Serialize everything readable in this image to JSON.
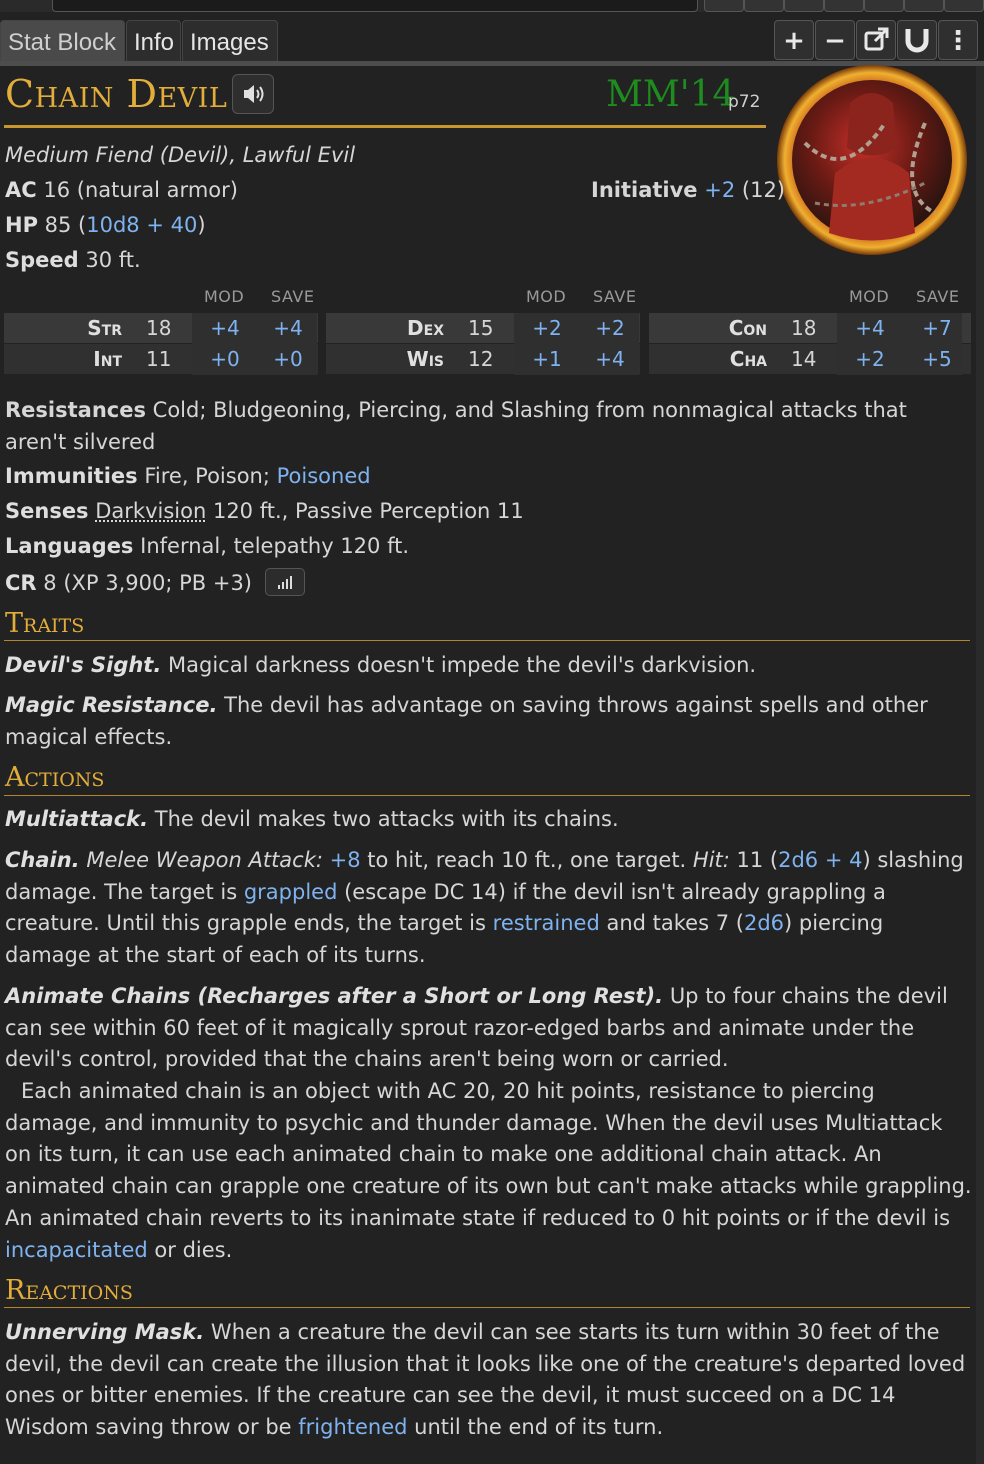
{
  "tabs": [
    {
      "label": "Stat Block",
      "active": true
    },
    {
      "label": "Info",
      "active": false
    },
    {
      "label": "Images",
      "active": false
    }
  ],
  "toolbar": {
    "icons": [
      "plus-icon",
      "minus-icon",
      "popout-icon",
      "magnet-icon",
      "more-vertical-icon"
    ],
    "plus": "+",
    "minus": "−",
    "more": "⋮"
  },
  "monster": {
    "name": "Chain Devil",
    "source": "MM'14",
    "page": "p72",
    "type": "Medium Fiend (Devil), Lawful Evil",
    "ac_label": "AC",
    "ac_value": "16 (natural armor)",
    "initiative_label": "Initiative",
    "initiative_mod": "+2",
    "initiative_score": "(12)",
    "hp_label": "HP",
    "hp_value": "85 (",
    "hp_formula": "10d8 + 40",
    "hp_close": ")",
    "speed_label": "Speed",
    "speed_value": "30 ft."
  },
  "abilities": {
    "mod_header": "MOD",
    "save_header": "SAVE",
    "groups": [
      {
        "rows": [
          {
            "name": "Str",
            "score": "18",
            "mod": "+4",
            "save": "+4"
          },
          {
            "name": "Int",
            "score": "11",
            "mod": "+0",
            "save": "+0"
          }
        ]
      },
      {
        "rows": [
          {
            "name": "Dex",
            "score": "15",
            "mod": "+2",
            "save": "+2"
          },
          {
            "name": "Wis",
            "score": "12",
            "mod": "+1",
            "save": "+4"
          }
        ]
      },
      {
        "rows": [
          {
            "name": "Con",
            "score": "18",
            "mod": "+4",
            "save": "+7"
          },
          {
            "name": "Cha",
            "score": "14",
            "mod": "+2",
            "save": "+5"
          }
        ]
      }
    ]
  },
  "details": {
    "resistances_label": "Resistances",
    "resistances_value": "Cold; Bludgeoning, Piercing, and Slashing from nonmagical attacks that",
    "resistances_value2": "aren't silvered",
    "immunities_label": "Immunities",
    "immunities_value": "Fire, Poison; ",
    "immunities_link": "Poisoned",
    "senses_label": "Senses",
    "senses_link": "Darkvision",
    "senses_value": " 120 ft., Passive Perception 11",
    "languages_label": "Languages",
    "languages_value": "Infernal, telepathy 120 ft.",
    "cr_label": "CR",
    "cr_value": "8 (XP 3,900; PB +3)"
  },
  "sections": {
    "traits": "Traits",
    "actions": "Actions",
    "reactions": "Reactions"
  },
  "traits": [
    {
      "name": "Devil's Sight.",
      "text": " Magical darkness doesn't impede the devil's darkvision."
    },
    {
      "name": "Magic Resistance.",
      "text": " The devil has advantage on saving throws against spells and other magical effects."
    }
  ],
  "actions": {
    "multiattack_name": "Multiattack.",
    "multiattack_text": " The devil makes two attacks with its chains.",
    "chain_name": "Chain.",
    "chain_attack_type": "Melee Weapon Attack:",
    "chain_to_hit": "+8",
    "chain_t1": " to hit, reach 10 ft., one target. ",
    "chain_hit_label": "Hit:",
    "chain_t2": " 11 (",
    "chain_dmg1": "2d6 + 4",
    "chain_t3": ") slashing damage. The target is ",
    "chain_grappled": "grappled",
    "chain_t4": " (escape DC 14) if the devil isn't already grappling a creature. Until this grapple ends, the target is ",
    "chain_restrained": "restrained",
    "chain_t5": " and takes 7 (",
    "chain_dmg2": "2d6",
    "chain_t6": ") piercing damage at the start of each of its turns.",
    "animate_name": "Animate Chains (Recharges after a Short or Long Rest).",
    "animate_text": " Up to four chains the devil can see within 60 feet of it magically sprout razor-edged barbs and animate under the devil's control, provided that the chains aren't being worn or carried.",
    "animate_text2": "Each animated chain is an object with AC 20, 20 hit points, resistance to piercing damage, and immunity to psychic and thunder damage. When the devil uses Multiattack on its turn, it can use each animated chain to make one additional chain attack. An animated chain can grapple one creature of its own but can't make attacks while grappling. An animated chain reverts to its inanimate state if reduced to 0 hit points or if the devil is ",
    "animate_link": "incapacitated",
    "animate_end": " or dies."
  },
  "reactions": {
    "mask_name": "Unnerving Mask.",
    "mask_text": " When a creature the devil can see starts its turn within 30 feet of the devil, the devil can create the illusion that it looks like one of the creature's departed loved ones or bitter enemies. If the creature can see the devil, it must succeed on a DC 14 Wisdom saving throw or be ",
    "mask_link": "frightened",
    "mask_end": " until the end of its turn."
  },
  "colors": {
    "accent": "#e2ad3a",
    "source": "#1e8c1e",
    "link": "#7fb3f0",
    "background": "#222222"
  }
}
